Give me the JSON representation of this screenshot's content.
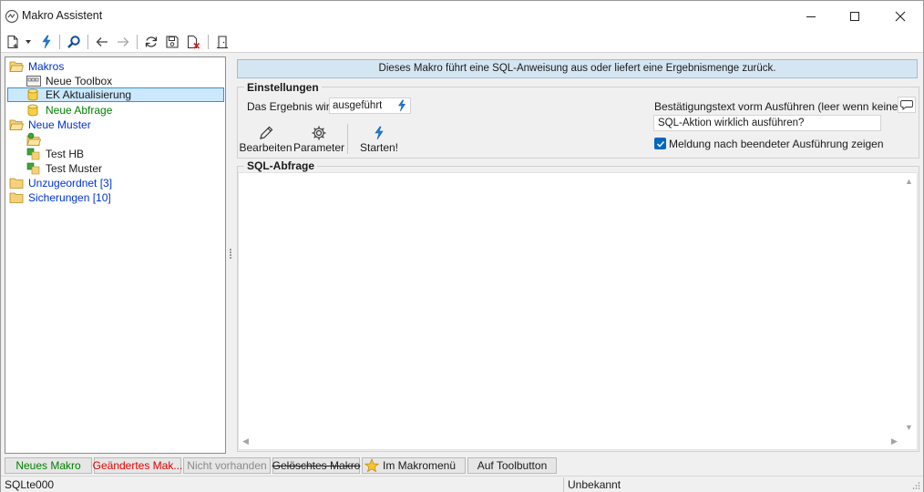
{
  "window": {
    "title": "Makro Assistent"
  },
  "tree": {
    "items": [
      {
        "label": "Makros",
        "color": "#0033cc"
      },
      {
        "label": "Neue Toolbox",
        "color": "#1a1a1a"
      },
      {
        "label": "EK Aktualisierung",
        "color": "#1a1a1a",
        "selected": true
      },
      {
        "label": "Neue Abfrage",
        "color": "#008000"
      },
      {
        "label": "Neue Muster",
        "color": "#0033cc"
      },
      {
        "label": "",
        "color": "#1a1a1a"
      },
      {
        "label": "Test HB",
        "color": "#1a1a1a"
      },
      {
        "label": "Test Muster",
        "color": "#1a1a1a"
      },
      {
        "label": "Unzugeordnet [3]",
        "color": "#0033cc"
      },
      {
        "label": "Sicherungen [10]",
        "color": "#0033cc"
      }
    ]
  },
  "info": {
    "text": "Dieses Makro führt eine SQL-Anweisung aus oder liefert eine Ergebnismenge zurück."
  },
  "settings": {
    "title": "Einstellungen",
    "result_label": "Das Ergebnis wird",
    "result_value": "ausgeführt",
    "edit_label": "Bearbeiten",
    "params_label": "Parameter",
    "start_label": "Starten!",
    "confirm_label": "Bestätigungstext vorm Ausführen (leer wenn keine)",
    "confirm_value": "SQL-Aktion wirklich ausführen?",
    "notify_label": "Meldung nach beendeter Ausführung zeigen",
    "notify_checked": true
  },
  "sql": {
    "title": "SQL-Abfrage",
    "value": ""
  },
  "legend": {
    "items": [
      {
        "label": "Neues Makro",
        "color": "#008000"
      },
      {
        "label": "Geändertes Mak...",
        "color": "#e00000"
      },
      {
        "label": "Nicht vorhanden",
        "color": "#8a8a8a"
      },
      {
        "label": "Gelöschtes Makro",
        "color": "#1a1a1a",
        "strike": true
      },
      {
        "label": "Im Makromenü",
        "color": "#1a1a1a",
        "icon": "star-icon"
      },
      {
        "label": "Auf Toolbutton",
        "color": "#1a1a1a"
      }
    ]
  },
  "status": {
    "left": "SQLte000",
    "right": "Unbekannt"
  },
  "colors": {
    "accent": "#0067c0",
    "selection": "#cce8ff",
    "info_bg": "#d5e6f3"
  }
}
